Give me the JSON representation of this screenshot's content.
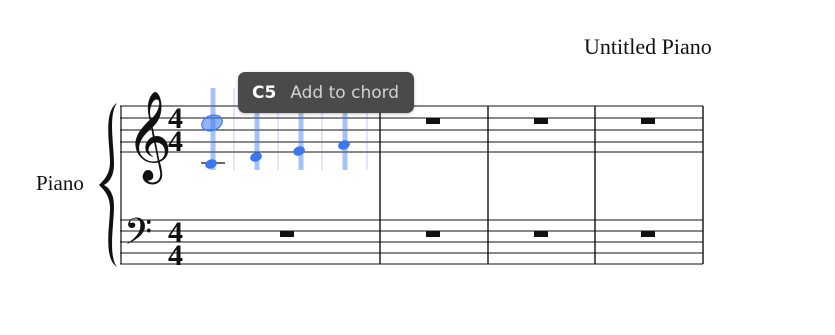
{
  "score": {
    "title": "Untitled Piano",
    "instrument": "Piano",
    "time_signature": {
      "top": "4",
      "bottom": "4"
    },
    "measure_count": 4
  },
  "tooltip": {
    "pitch": "C5",
    "action": "Add to chord"
  },
  "colors": {
    "note_highlight": "#3b78f0",
    "tooltip_bg": "#4a4a4a",
    "staff": "#111111"
  },
  "icons": [
    "treble-clef-icon",
    "bass-clef-icon",
    "brace-icon",
    "whole-rest-icon"
  ]
}
